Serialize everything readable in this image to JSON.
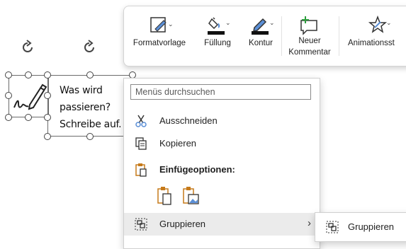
{
  "slide": {
    "textbox_lines": [
      "Was wird",
      "passieren?",
      "Schreibe auf."
    ]
  },
  "mini_toolbar": {
    "items": [
      {
        "label": "Formatvorlage",
        "icon": "format-style-icon"
      },
      {
        "label": "Füllung",
        "icon": "fill-bucket-icon"
      },
      {
        "label": "Kontur",
        "icon": "outline-pen-icon"
      },
      {
        "label_lines": [
          "Neuer",
          "Kommentar"
        ],
        "icon": "new-comment-icon"
      },
      {
        "label": "Animationsst",
        "icon": "animation-star-icon"
      }
    ]
  },
  "context_menu": {
    "search_placeholder": "Menüs durchsuchen",
    "items": [
      {
        "label": "Ausschneiden",
        "icon": "scissors-icon"
      },
      {
        "label": "Kopieren",
        "icon": "copy-icon"
      },
      {
        "label": "Einfügeoptionen:",
        "icon": "paste-icon"
      },
      {
        "label": "Gruppieren",
        "icon": "group-icon"
      }
    ],
    "paste_options": [
      "paste-keep-format-icon",
      "paste-as-picture-icon"
    ]
  },
  "submenu": {
    "items": [
      {
        "label": "Gruppieren",
        "icon": "group-icon"
      }
    ]
  },
  "colors": {
    "accent_orange": "#c67a1a",
    "comment_green": "#2e9e3e",
    "pen_blue": "#5b8fd6"
  }
}
